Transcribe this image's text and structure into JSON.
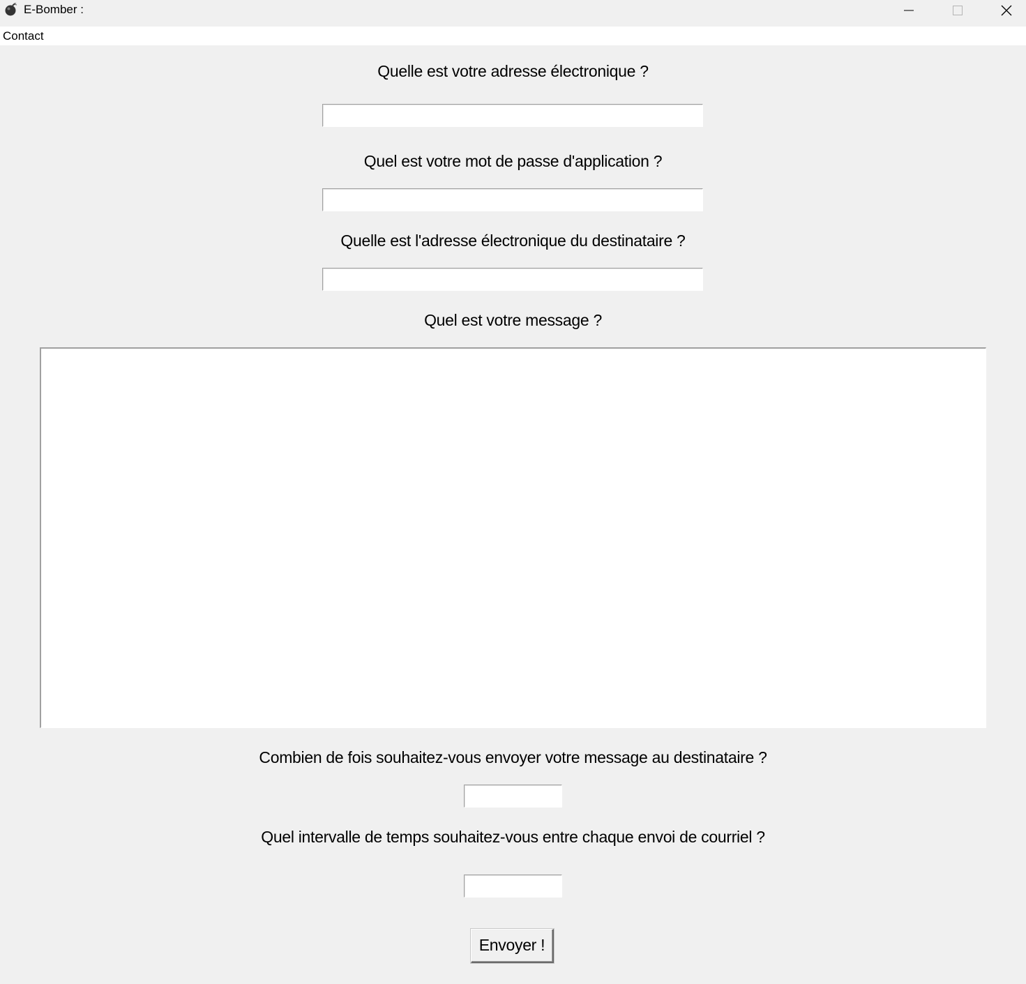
{
  "window": {
    "title": "E-Bomber :",
    "app_icon": "bomb-icon",
    "controls": {
      "minimize": "minimize-icon",
      "maximize": "maximize-icon",
      "close": "close-icon"
    }
  },
  "menubar": {
    "items": [
      {
        "label": "Contact"
      }
    ]
  },
  "form": {
    "sender_email": {
      "label": "Quelle est votre adresse électronique ?",
      "value": ""
    },
    "app_password": {
      "label": "Quel est votre mot de passe d'application ?",
      "value": ""
    },
    "recipient_email": {
      "label": "Quelle est l'adresse électronique du destinataire ?",
      "value": ""
    },
    "message": {
      "label": "Quel est votre message ?",
      "value": ""
    },
    "send_count": {
      "label": "Combien de fois souhaitez-vous envoyer votre message au destinataire ?",
      "value": ""
    },
    "interval": {
      "label": "Quel intervalle de temps souhaitez-vous entre chaque envoi de courriel ?",
      "value": ""
    },
    "submit_label": "Envoyer !"
  }
}
